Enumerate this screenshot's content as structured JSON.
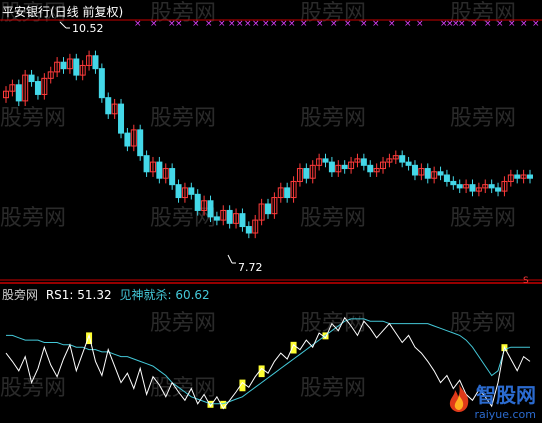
{
  "header": {
    "title": "平安银行(日线 前复权)"
  },
  "price_panel": {
    "high_marker": "10.52",
    "low_marker": "7.72",
    "x_marker": "×",
    "s_marker": "S"
  },
  "indicator_panel": {
    "watermark_prefix": "股旁网",
    "rs1_label": "RS1: 51.32",
    "jian_label": "见神就杀: 60.62"
  },
  "watermark": {
    "text": "股旁网"
  },
  "logo": {
    "name": "智股网",
    "url": "raiyue.com"
  },
  "colors": {
    "background": "#000000",
    "up_candle": "#ff3b3b",
    "down_candle": "#44d8e8",
    "separator": "#c80000",
    "marker_x": "#e040ff",
    "rs1_line": "#ffffff",
    "jian_line": "#44c8d8",
    "signal": "#ffff33",
    "watermark": "#2a2a2a"
  },
  "chart_data": [
    {
      "type": "candlestick",
      "title": "平安银行(日线 前复权)",
      "annotations": {
        "high": 10.52,
        "low": 7.72
      },
      "ylim": [
        7.3,
        10.9
      ],
      "close": [
        9.95,
        10.05,
        9.8,
        10.2,
        10.1,
        9.9,
        10.15,
        10.25,
        10.4,
        10.3,
        10.45,
        10.2,
        10.35,
        10.5,
        10.3,
        9.85,
        9.6,
        9.75,
        9.3,
        9.1,
        9.35,
        8.95,
        8.7,
        8.85,
        8.6,
        8.75,
        8.5,
        8.3,
        8.45,
        8.35,
        8.1,
        8.25,
        8.0,
        7.95,
        8.1,
        7.9,
        8.05,
        7.85,
        7.75,
        7.95,
        8.2,
        8.05,
        8.3,
        8.45,
        8.3,
        8.55,
        8.75,
        8.6,
        8.8,
        8.9,
        8.85,
        8.7,
        8.8,
        8.75,
        8.85,
        8.9,
        8.8,
        8.7,
        8.75,
        8.85,
        8.9,
        8.95,
        8.85,
        8.8,
        8.65,
        8.75,
        8.6,
        8.7,
        8.65,
        8.55,
        8.5,
        8.45,
        8.5,
        8.4,
        8.45,
        8.5,
        8.45,
        8.4,
        8.55,
        8.65,
        8.6,
        8.65,
        8.6
      ],
      "open": [
        9.85,
        9.95,
        10.05,
        9.8,
        10.2,
        10.1,
        9.9,
        10.15,
        10.25,
        10.4,
        10.3,
        10.45,
        10.2,
        10.35,
        10.5,
        10.3,
        9.85,
        9.6,
        9.75,
        9.3,
        9.1,
        9.35,
        8.95,
        8.7,
        8.85,
        8.6,
        8.75,
        8.5,
        8.3,
        8.45,
        8.35,
        8.1,
        8.25,
        8.0,
        7.95,
        8.1,
        7.9,
        8.05,
        7.85,
        7.75,
        7.95,
        8.2,
        8.05,
        8.3,
        8.45,
        8.3,
        8.55,
        8.75,
        8.6,
        8.8,
        8.9,
        8.85,
        8.7,
        8.8,
        8.75,
        8.85,
        8.9,
        8.8,
        8.7,
        8.75,
        8.85,
        8.9,
        8.95,
        8.85,
        8.8,
        8.65,
        8.75,
        8.6,
        8.7,
        8.65,
        8.55,
        8.5,
        8.45,
        8.5,
        8.4,
        8.45,
        8.5,
        8.45,
        8.4,
        8.55,
        8.65,
        8.6,
        8.65
      ]
    },
    {
      "type": "line",
      "series": [
        {
          "name": "RS1",
          "last": 51.32
        },
        {
          "name": "见神就杀",
          "last": 60.62
        }
      ],
      "ylim": [
        0,
        100
      ],
      "rs1": [
        55,
        48,
        40,
        52,
        30,
        42,
        60,
        45,
        35,
        50,
        62,
        40,
        55,
        70,
        48,
        36,
        58,
        44,
        30,
        38,
        25,
        42,
        20,
        35,
        28,
        18,
        30,
        22,
        15,
        25,
        12,
        20,
        10,
        18,
        8,
        15,
        22,
        30,
        26,
        35,
        42,
        38,
        48,
        55,
        50,
        62,
        58,
        66,
        60,
        72,
        68,
        80,
        74,
        85,
        78,
        70,
        82,
        76,
        68,
        74,
        80,
        72,
        64,
        70,
        60,
        55,
        48,
        40,
        30,
        36,
        25,
        32,
        20,
        15,
        24,
        18,
        10,
        30,
        60,
        50,
        40,
        52,
        48
      ],
      "jian": [
        70,
        70,
        68,
        66,
        66,
        66,
        64,
        64,
        64,
        62,
        62,
        60,
        60,
        58,
        58,
        56,
        56,
        54,
        52,
        52,
        50,
        48,
        46,
        44,
        40,
        36,
        30,
        26,
        22,
        18,
        16,
        14,
        12,
        12,
        12,
        14,
        16,
        18,
        22,
        26,
        30,
        34,
        38,
        42,
        46,
        50,
        54,
        58,
        62,
        66,
        70,
        74,
        78,
        82,
        84,
        84,
        84,
        82,
        82,
        82,
        80,
        80,
        80,
        80,
        80,
        80,
        80,
        78,
        76,
        74,
        72,
        70,
        66,
        60,
        52,
        44,
        36,
        40,
        58,
        60,
        60,
        60,
        60
      ],
      "signals": [
        13,
        32,
        34,
        37,
        40,
        45,
        50,
        78
      ]
    }
  ]
}
